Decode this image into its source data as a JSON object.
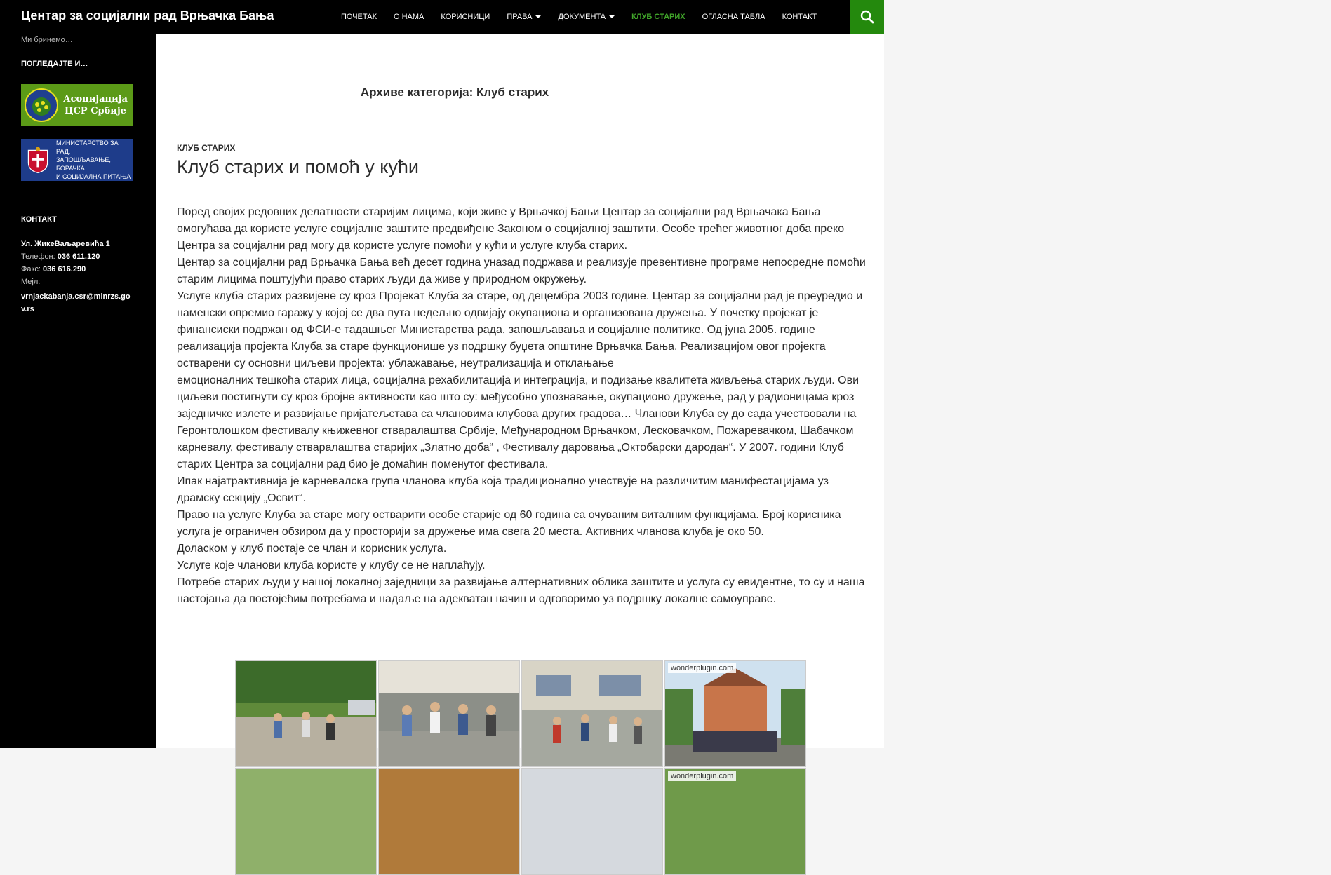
{
  "header": {
    "site_title": "Центар за социјални рад Врњачка Бања",
    "nav": [
      {
        "label": "Почетак",
        "dropdown": false,
        "active": false
      },
      {
        "label": "О нама",
        "dropdown": false,
        "active": false
      },
      {
        "label": "Корисници",
        "dropdown": false,
        "active": false
      },
      {
        "label": "Права",
        "dropdown": true,
        "active": false
      },
      {
        "label": "Документа",
        "dropdown": true,
        "active": false
      },
      {
        "label": "Клуб старих",
        "dropdown": false,
        "active": true
      },
      {
        "label": "Огласна табла",
        "dropdown": false,
        "active": false
      },
      {
        "label": "Контакт",
        "dropdown": false,
        "active": false
      }
    ],
    "search_icon": "search-icon"
  },
  "sidebar": {
    "tagline": "Ми бринемо…",
    "widget_links_title": "Погледајте и…",
    "banners": {
      "association": {
        "line1": "Асоцијација",
        "line2": "ЦСР Србије",
        "logo_text": "АСОЦИЈАЦИЈА ЦЕНТАРА ЗА СОЦИЈАЛНИ РАД СРБИЈЕ"
      },
      "ministry": {
        "line1": "МИНИСТАРСТВО ЗА РАД,",
        "line2": "ЗАПОШЉАВАЊЕ, БОРАЧКА",
        "line3": "И СОЦИЈАЛНА ПИТАЊА"
      }
    },
    "contact_title": "Контакт",
    "contact": {
      "address": "Ул. ЖикеВаљаревића 1",
      "phone_label": "Телефон:",
      "phone": "036 611.120",
      "fax_label": "Факс:",
      "fax": "036 616.290",
      "mail_label": "Мејл:",
      "mail": "vrnjackabanja.csr@minrzs.gov.rs"
    }
  },
  "main": {
    "archive_title": "Архиве категорија: Клуб старих",
    "category": "Клуб старих",
    "post_title": "Клуб старих и помоћ у кући",
    "paragraphs": [
      "Поред својих редовних делатности старијим лицима, који живе у Врњачкој Бањи Центар за социјални рад Врњачака Бања омогућава да користе услуге социјалне заштите предвиђене Законом о социјалној заштити. Особе трећег животног доба преко Центра за социјални рад могу да користе услуге помоћи у кући и услуге клуба старих.",
      "Центар за социјални рад Врњачка Бања већ десет година уназад подржава и реализује превентивне програме непосредне помоћи старим лицима поштујући право старих људи да живе у природном окружењу.",
      "Услуге клуба старих развијене су кроз Пројекат Клуба за старе, од децембра 2003 године. Центар за социјални рад је преуредио и наменски опремио гаражу у којој се два пута недељно одвијају окупациона и организована дружења. У почетку пројекат је финансиски подржан од ФСИ-е тадашњег Министарства рада, запошљавања и социјалне политике. Од јуна 2005. године реализација пројекта Клуба за старе функционише уз подршку буџета општине Врњачка Бања. Реализацијом овог пројекта остварени су основни циљеви пројекта: ублажавање, неутрализација и отклањање",
      "емоционалних тешкоћа старих лица, социјална рехабилитација и интеграција, и подизање квалитета живљења старих људи. Ови циљеви постигнути су кроз бројне активности као што су: међусобно упознавање, окупационо дружење, рад у радионицама кроз заједничке излете и развијање пријатељстава са члановима клубова других градова… Чланови Клуба су до сада учествовали на Геронтолошком фестивалу књижевног стваралаштва Србије, Међународном Врњачком, Лесковачком, Пожаревачком, Шабачком карневалу, фестивалу стваралаштва старијих „Златно доба“ , Фестивалу даровања „Октобарски дародан“. У 2007. години Клуб старих Центра за социјални рад био је домаћин поменутог фестивала.",
      "Ипак најатрактивнија је карневалска група чланова клуба која традиционално учествује на различитим манифестацијама уз драмску секцију „Освит“.",
      "Право на услуге Клуба за старе могу остварити особе старије од 60 година са очуваним виталним функцијама. Број корисника услуга је ограничен обзиром да у просторији за дружење има свега 20 места. Активних чланова клуба је око 50.",
      "Доласком у клуб постаје се члан и корисник услуга.",
      "Услуге које чланови клуба користе у клубу се не наплаћују.",
      "Потребе старих људи у нашој локалној заједници за развијање алтернативних облика заштите и услуга су евидентне, то су и наша настојања да постојећим потребама и надаље на адекватан начин и одговоримо уз подршку локалне самоуправе."
    ],
    "gallery_watermark": "wonderplugin.com"
  },
  "colors": {
    "accent": "#41a62a",
    "search_bg": "#24890d",
    "header_bg": "#000000"
  }
}
